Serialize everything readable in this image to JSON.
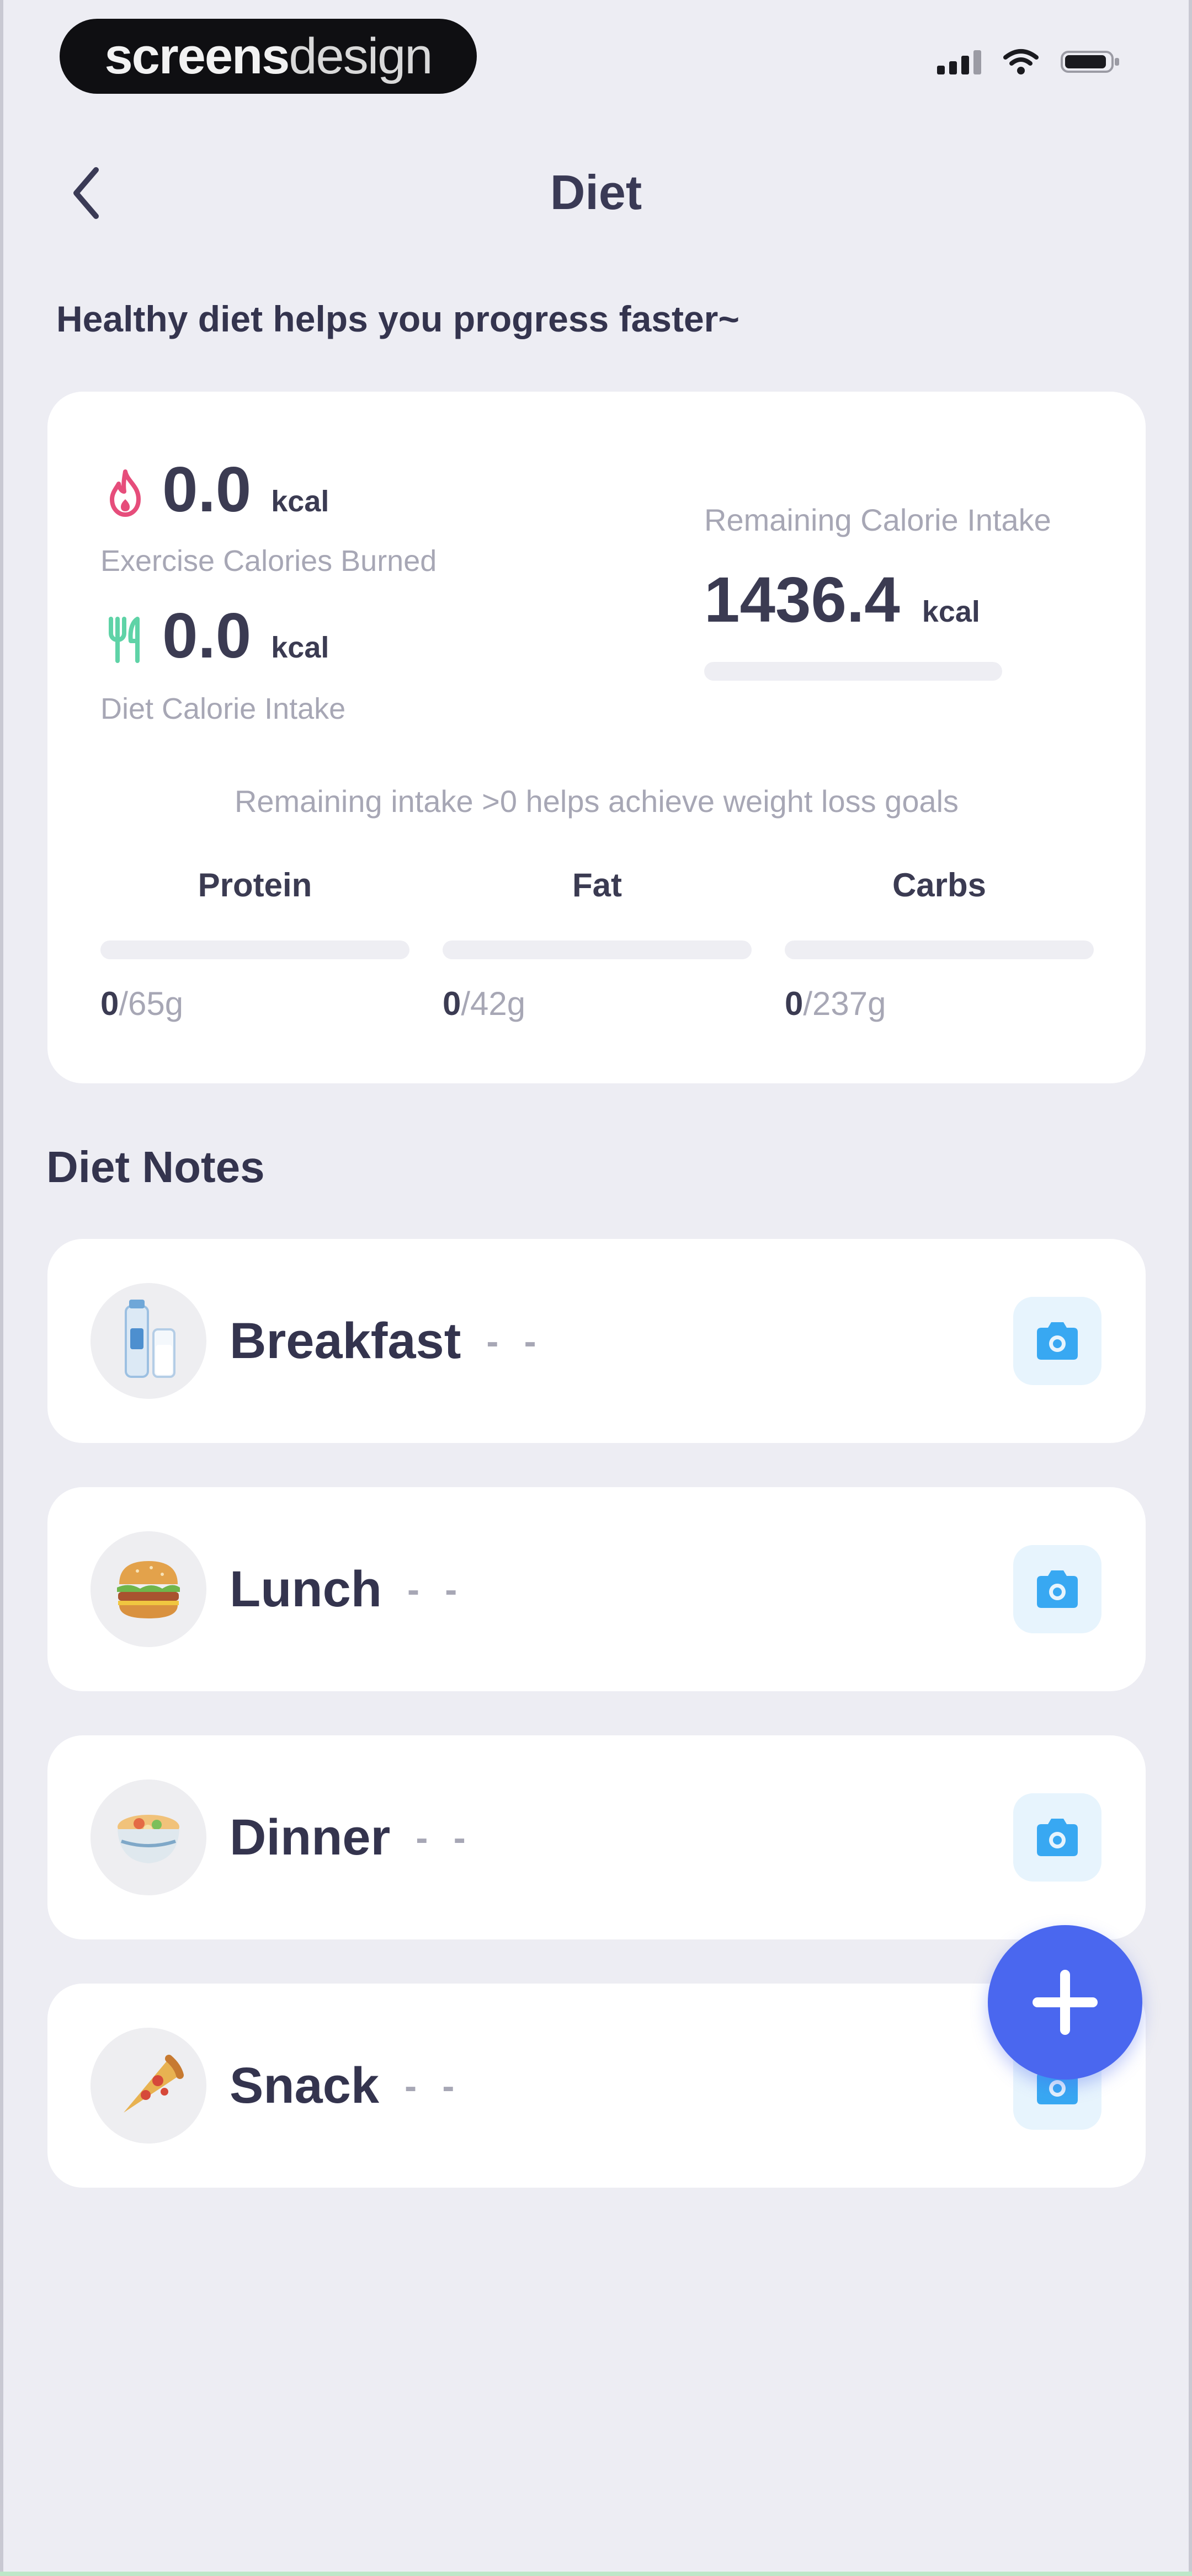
{
  "status_bar": {
    "brand_bold": "screens",
    "brand_light": "design"
  },
  "nav": {
    "title": "Diet"
  },
  "subtitle": "Healthy diet helps you progress faster~",
  "summary": {
    "exercise": {
      "value": "0.0",
      "unit": "kcal",
      "label": "Exercise Calories Burned"
    },
    "diet": {
      "value": "0.0",
      "unit": "kcal",
      "label": "Diet Calorie Intake"
    },
    "remaining": {
      "label": "Remaining Calorie Intake",
      "value": "1436.4",
      "unit": "kcal",
      "progress": 0
    },
    "hint": "Remaining intake >0 helps achieve weight loss goals",
    "macros": [
      {
        "name": "Protein",
        "current": "0",
        "total": "/65g",
        "progress": 0
      },
      {
        "name": "Fat",
        "current": "0",
        "total": "/42g",
        "progress": 0
      },
      {
        "name": "Carbs",
        "current": "0",
        "total": "/237g",
        "progress": 0
      }
    ]
  },
  "diet_notes": {
    "title": "Diet Notes",
    "meals": [
      {
        "name": "Breakfast",
        "value": "- -",
        "icon": "milk-icon"
      },
      {
        "name": "Lunch",
        "value": "- -",
        "icon": "burger-icon"
      },
      {
        "name": "Dinner",
        "value": "- -",
        "icon": "noodle-bowl-icon"
      },
      {
        "name": "Snack",
        "value": "- -",
        "icon": "pizza-slice-icon"
      }
    ]
  },
  "colors": {
    "accent": "#4a67ef",
    "exercise_icon": "#e64d7b",
    "diet_icon": "#5fd3a7",
    "camera": "#38a8f2"
  }
}
